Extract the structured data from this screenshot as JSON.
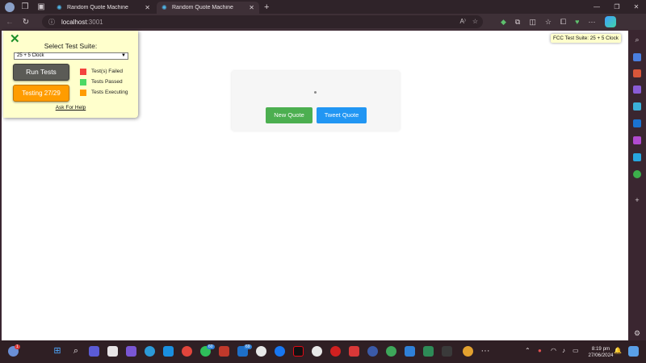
{
  "browser": {
    "tabs": [
      {
        "title": "Random Quote Machine",
        "active": false
      },
      {
        "title": "Random Quote Machine",
        "active": true
      }
    ],
    "new_tab_glyph": "+",
    "address": {
      "host": "localhost",
      "port": ":3001"
    }
  },
  "fcc": {
    "heading": "Select Test Suite:",
    "selected_suite": "25 + 5 Clock",
    "run_label": "Run Tests",
    "testing_label": "Testing 27/29",
    "legend": [
      {
        "label": "Test(s) Failed",
        "color": "#f4433c"
      },
      {
        "label": "Tests Passed",
        "color": "#4cd964"
      },
      {
        "label": "Tests Executing",
        "color": "#ff9c00"
      }
    ],
    "help_label": "Ask For Help",
    "badge_label": "FCC Test Suite: 25 + 5 Clock"
  },
  "quote": {
    "new_quote_label": "New Quote",
    "tweet_quote_label": "Tweet Quote"
  },
  "taskbar": {
    "time": "8:19 pm",
    "date": "27/06/2024",
    "notification_count": "1",
    "whatsapp_badge": "60",
    "outlook_badge": "69"
  },
  "colors": {
    "accent_green": "#4caf50",
    "accent_blue": "#2196f3",
    "panel_bg": "#ffffcc",
    "testing_orange": "#ff9c00"
  }
}
